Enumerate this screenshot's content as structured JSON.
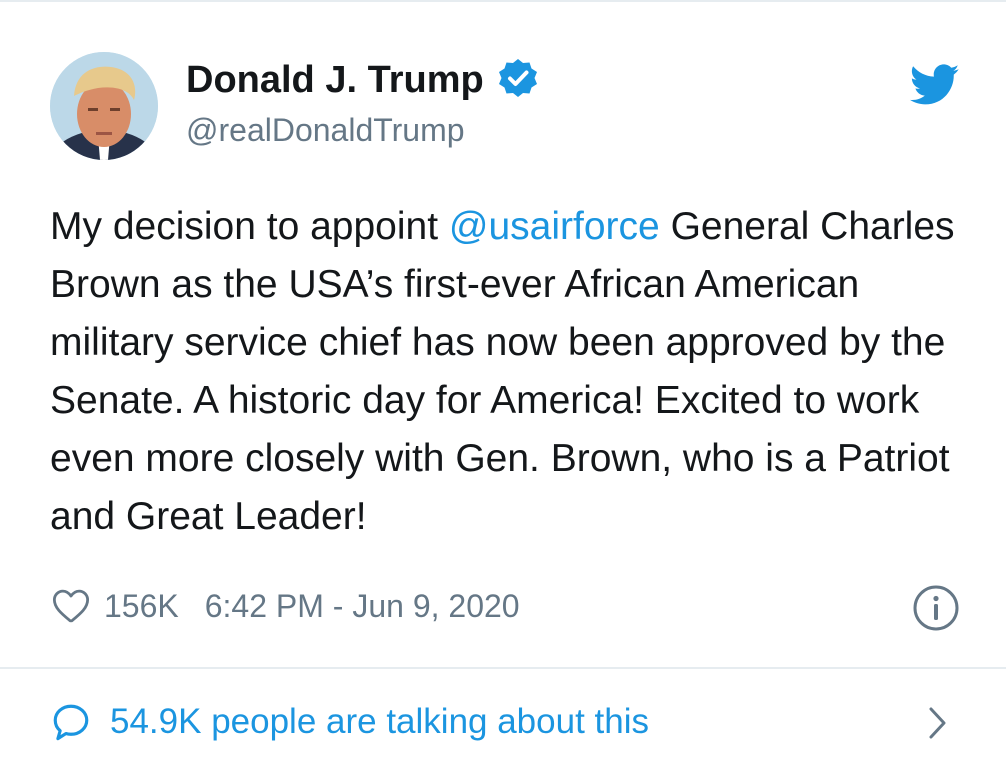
{
  "author": {
    "display_name": "Donald J. Trump",
    "handle": "@realDonaldTrump",
    "verified": true,
    "avatar_icon": "profile-photo"
  },
  "tweet": {
    "text_before": "My decision to appoint ",
    "mention": "@usairforce",
    "text_after": " General Charles Brown as the USA’s first-ever African American military service chief has now been approved by the Senate. A historic day for America! Excited to work even more closely with Gen. Brown, who is a Patriot and Great Leader!"
  },
  "meta": {
    "like_count": "156K",
    "timestamp": "6:42 PM - Jun 9, 2020"
  },
  "footer": {
    "talking_text": "54.9K people are talking about this"
  },
  "icons": {
    "brand": "twitter-bird-icon",
    "verified": "verified-badge-icon",
    "like": "heart-icon",
    "info": "info-icon",
    "reply": "speech-bubble-icon",
    "more": "chevron-right-icon"
  },
  "colors": {
    "accent": "#1b95e0",
    "text": "#14171a",
    "muted": "#657786",
    "divider": "#e6ecf0"
  }
}
